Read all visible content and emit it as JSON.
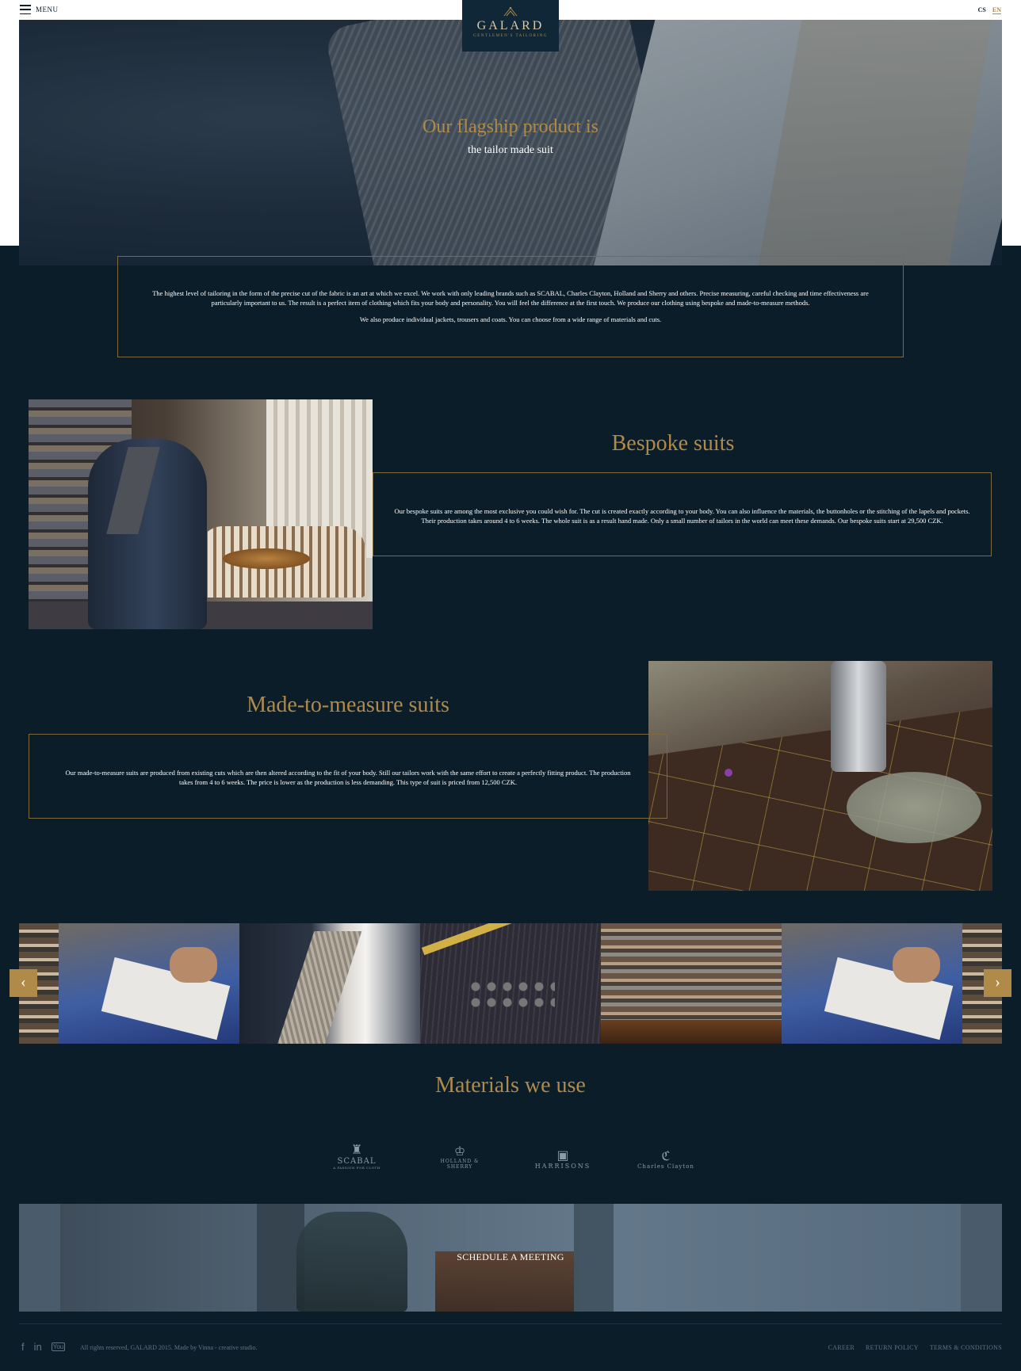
{
  "header": {
    "menu_label": "MENU",
    "logo_word": "GALARD",
    "logo_tagline": "GENTLEMEN'S TAILORING",
    "lang_cs": "CS",
    "lang_en": "EN"
  },
  "hero": {
    "title": "Our flagship product is",
    "subtitle": "the tailor made suit"
  },
  "intro": {
    "paragraph1": "The highest level of tailoring in the form of the precise cut of the fabric is an art at which we excel. We work with only leading brands such as SCABAL, Charles Clayton, Holland and Sherry and others. Precise measuring, careful checking and time effectiveness are particularly important to us. The result is a perfect item of clothing which fits your body and personality. You will feel the difference at the first touch. We produce our clothing using bespoke and made-to-measure methods.",
    "paragraph2": "We also produce individual jackets, trousers and coats. You can choose from a wide range of materials and cuts."
  },
  "bespoke": {
    "title": "Bespoke suits",
    "text": "Our bespoke suits are among the most exclusive you could wish for. The cut is created exactly according to your body. You can also influence the materials, the buttonholes or the stitching of the lapels and pockets. Their production takes around 4 to 6 weeks. The whole suit is as a result hand made. Only a small number of tailors in the world can meet these demands. Our bespoke suits start at 29,500 CZK."
  },
  "made_to_measure": {
    "title": "Made-to-measure suits",
    "text": "Our made-to-measure suits are produced from existing cuts which are then altered according to the fit of your body. Still our tailors work with the same effort to create a perfectly fitting product. The production takes from 4 to 6 weeks. The price is lower as the production is less demanding. This type of suit is priced from 12,500 CZK."
  },
  "carousel": {
    "prev_icon": "chevron-left-icon",
    "next_icon": "chevron-right-icon",
    "prev_glyph": "‹",
    "next_glyph": "›"
  },
  "materials": {
    "title": "Materials we use",
    "brands": [
      {
        "name": "SCABAL",
        "small": "A PASSION FOR CLOTH"
      },
      {
        "name": "HOLLAND & SHERRY",
        "small": ""
      },
      {
        "name": "HARRISONS",
        "small": ""
      },
      {
        "name": "Charles Clayton",
        "small": ""
      }
    ]
  },
  "schedule": {
    "button_label": "SCHEDULE A MEETING"
  },
  "footer": {
    "social": [
      "f",
      "in",
      "You"
    ],
    "copyright": "All rights reserved, GALARD 2015. Made by Vinna - creative studio.",
    "links": [
      "CAREER",
      "RETURN POLICY",
      "TERMS & CONDITIONS"
    ]
  },
  "colors": {
    "background": "#0b1d29",
    "accent_gold": "#b08a49",
    "border_gold": "#7d6a3f",
    "muted_text": "#5f7585"
  }
}
